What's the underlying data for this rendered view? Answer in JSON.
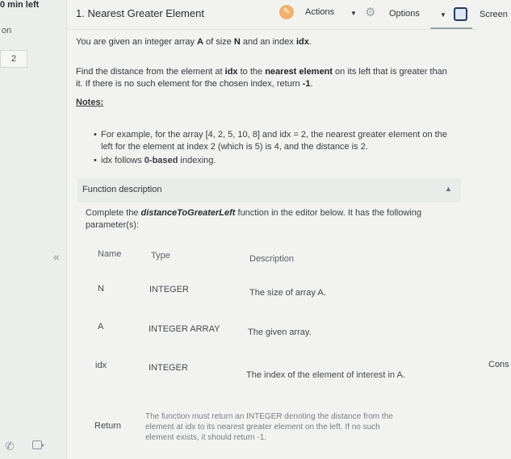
{
  "timer": "0 min left",
  "left_rail": {
    "label": "on",
    "question_number": "2",
    "collapse_icon": "«"
  },
  "header": {
    "title": "1. Nearest Greater Element",
    "actions_label": "Actions",
    "options_label": "Options",
    "screen_label": "Screen"
  },
  "problem": {
    "intro_before": "You are given an integer array ",
    "intro_A": "A",
    "intro_mid": " of size ",
    "intro_N": "N",
    "intro_and": " and an index ",
    "intro_idx": "idx",
    "intro_end": ".",
    "task_before": "Find the distance from the element at ",
    "task_idx": "idx",
    "task_mid": " to the ",
    "task_bold": "nearest element",
    "task_after": " on its left that is greater than",
    "task_line2_before": "it. If there is no such element for the chosen index, return ",
    "task_return": "-1",
    "task_line2_end": ".",
    "notes_label": "Notes:",
    "note1_line1": "For example, for the array [4, 2, 5, 10, 8] and idx = 2, the nearest greater element on the",
    "note1_line2": "left for the element at index 2 (which is 5) is 4, and the distance is 2.",
    "note2_before": "idx follows ",
    "note2_bold": "0-based",
    "note2_after": " indexing."
  },
  "function_description": {
    "header": "Function description",
    "line1_before": "Complete the ",
    "line1_func": "distanceToGreaterLeft",
    "line1_after": " function in the editor below. It has the following",
    "line2": "parameter(s):"
  },
  "params_table": {
    "headers": [
      "Name",
      "Type",
      "Description"
    ],
    "rows": [
      {
        "name": "N",
        "type": "INTEGER",
        "description": "The size of array A."
      },
      {
        "name": "A",
        "type": "INTEGER ARRAY",
        "description": "The given array."
      },
      {
        "name": "idx",
        "type": "INTEGER",
        "description": "The index of the element of interest in A."
      }
    ],
    "return_label": "Return",
    "return_line1": "The function must return an INTEGER denoting the distance from the",
    "return_line2": "element at idx to its nearest greater element on the left. If no such",
    "return_line3": "element exists, it should return -1."
  },
  "right_rail": {
    "cons_label": "Cons"
  }
}
